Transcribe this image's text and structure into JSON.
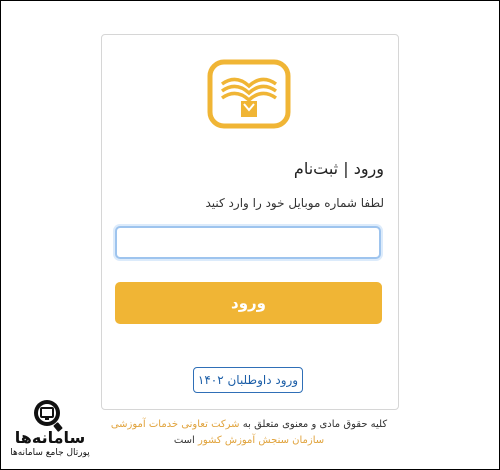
{
  "login": {
    "title": "ورود | ثبت‌نام",
    "hint": "لطفا شماره موبایل خود را وارد کنید",
    "mobile_value": "",
    "mobile_placeholder": "",
    "submit_label": "ورود",
    "applicants_label": "ورود داوطلبان ۱۴۰۲"
  },
  "footer": {
    "prefix": "کلیه حقوق مادی و معنوی متعلق به ",
    "link1": "شرکت تعاونی خدمات آموزشی",
    "link2": "سازمان سنجش آموزش کشور",
    "suffix": " است"
  },
  "watermark": {
    "brand": "سامانه‌ها",
    "subtitle": "پورتال جامع سامانه‌ها"
  },
  "icons": {
    "logo": "open-book-logo-icon",
    "watermark": "magnifier-monitor-icon"
  },
  "colors": {
    "accent": "#f0b535",
    "link": "#1d5fa8",
    "footer_link": "#e0a23a",
    "input_focus": "#9ec4ee"
  }
}
